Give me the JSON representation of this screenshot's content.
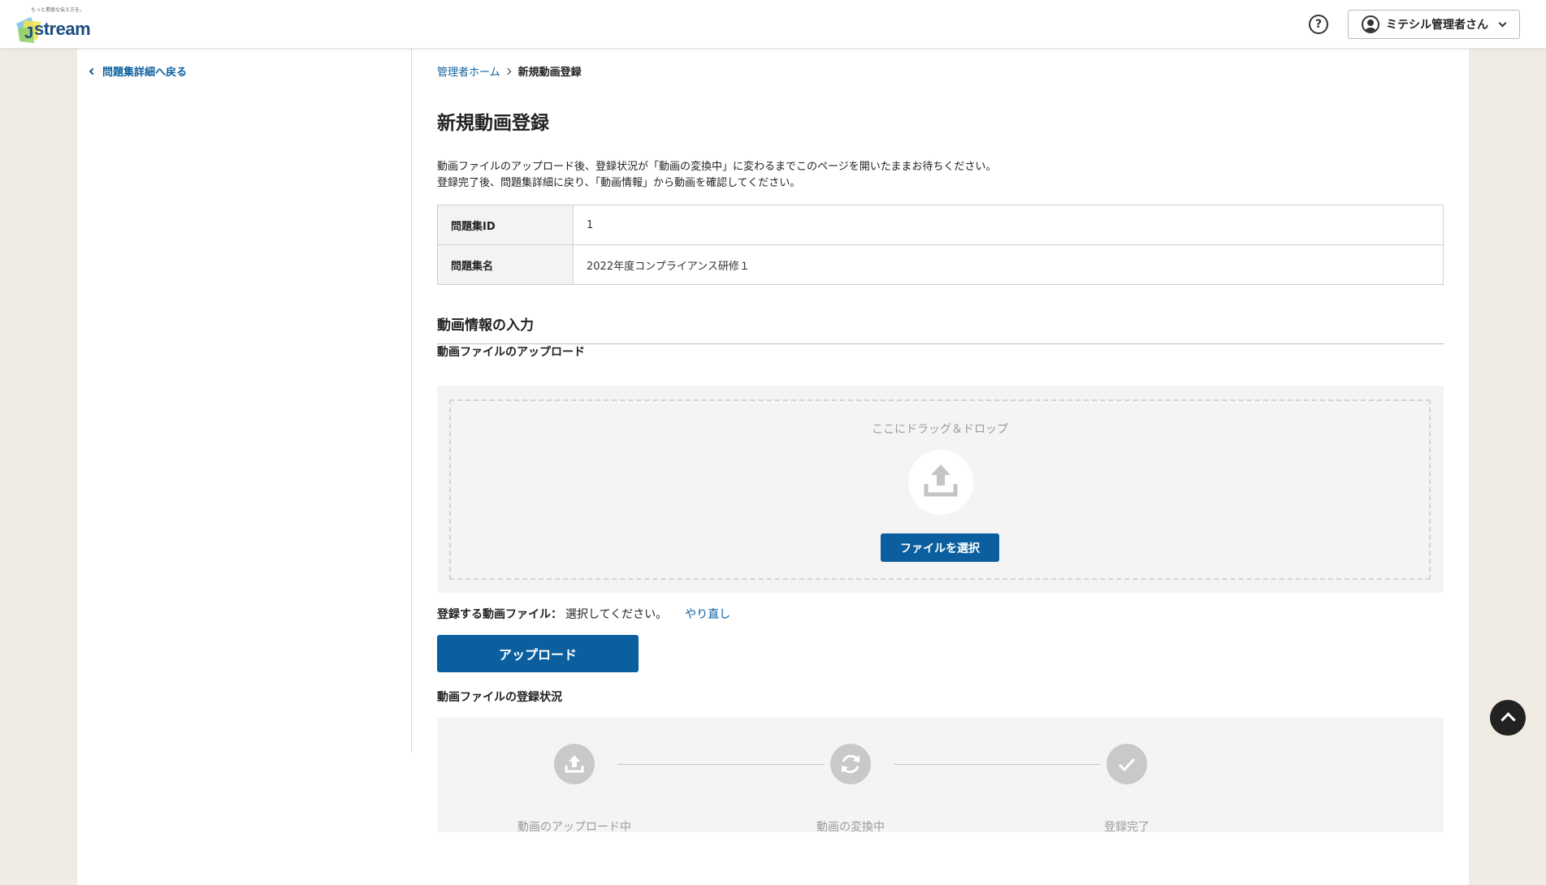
{
  "header": {
    "logo_tagline": "もっと素敵な伝え方を。",
    "logo_text": "stream",
    "help_icon_glyph": "?",
    "user_name": "ミテシル管理者さん"
  },
  "sidebar": {
    "back_link": "問題集詳細へ戻る"
  },
  "breadcrumb": {
    "home": "管理者ホーム",
    "current": "新規動画登録"
  },
  "page": {
    "title": "新規動画登録",
    "description_line1": "動画ファイルのアップロード後、登録状況が「動画の変換中」に変わるまでこのページを開いたままお待ちください。",
    "description_line2": "登録完了後、問題集詳細に戻り、「動画情報」から動画を確認してください。"
  },
  "info_table": [
    {
      "label": "問題集ID",
      "value": "1"
    },
    {
      "label": "問題集名",
      "value": "2022年度コンプライアンス研修１"
    }
  ],
  "section": {
    "title": "動画情報の入力",
    "upload_subtitle": "動画ファイルのアップロード",
    "drop_text": "ここにドラッグ＆ドロップ",
    "select_button": "ファイルを選択",
    "file_label": "登録する動画ファイル：",
    "file_value": "選択してください。",
    "retry_link": "やり直し",
    "upload_button": "アップロード",
    "status_subtitle": "動画ファイルの登録状況"
  },
  "status_steps": [
    {
      "label": "動画のアップロード中",
      "icon": "upload-icon"
    },
    {
      "label": "動画の変換中",
      "icon": "refresh-icon"
    },
    {
      "label": "登録完了",
      "icon": "check-icon"
    }
  ],
  "colors": {
    "accent": "#0b5f9e",
    "background": "#f1ece3",
    "step_inactive": "#c9c9c9"
  }
}
